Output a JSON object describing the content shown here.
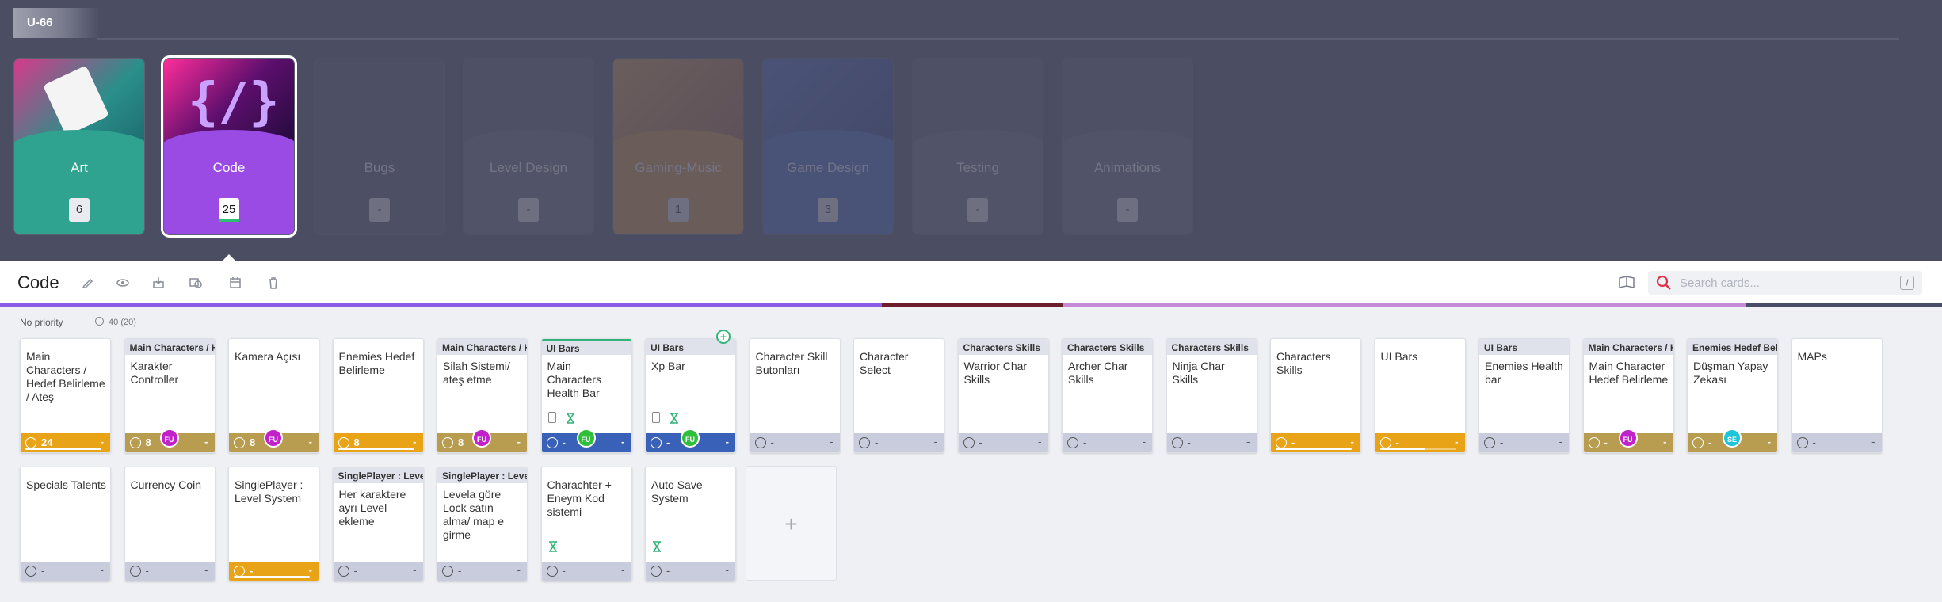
{
  "board": {
    "tab_label": "U-66"
  },
  "categories": [
    {
      "name": "Art",
      "count": "6"
    },
    {
      "name": "Code",
      "count": "25",
      "selected": true
    },
    {
      "name": "Bugs",
      "count": "-"
    },
    {
      "name": "Level Design",
      "count": "-"
    },
    {
      "name": "Gaming-Music",
      "count": "1"
    },
    {
      "name": "Game Design",
      "count": "3"
    },
    {
      "name": "Testing",
      "count": "-"
    },
    {
      "name": "Animations",
      "count": "-"
    }
  ],
  "header": {
    "title": "Code",
    "icons": [
      "edit-icon",
      "eye-icon",
      "archive-icon",
      "shapes-icon",
      "calendar-icon",
      "trash-icon"
    ],
    "search_placeholder": "Search cards...",
    "search_shortcut": "/"
  },
  "section": {
    "title": "No priority",
    "count": "40",
    "limit": "(20)"
  },
  "colors": {
    "accent": "#8a5ce6",
    "yellow": "#e8a317",
    "olive": "#b89c4f",
    "blue": "#3a61b8",
    "green": "#34b37a"
  },
  "cards_row1": [
    {
      "title": "Main Characters / Hedef Belirleme / Ateş",
      "foot": "yellow",
      "value": "24",
      "progress": 1.0
    },
    {
      "group": "Main Characters / Hedef",
      "title": "Karakter Controller",
      "foot": "olive",
      "value": "8",
      "avatar": "FU",
      "avatar_color": "#c021c9"
    },
    {
      "title": "Kamera Açısı",
      "foot": "olive",
      "value": "8",
      "avatar": "FU",
      "avatar_color": "#c021c9"
    },
    {
      "title": "Enemies Hedef Belirleme",
      "foot": "yellow",
      "value": "8",
      "progress": 1.0
    },
    {
      "group": "Main Characters / Hedef",
      "title": "Silah Sistemi/ ateş etme",
      "foot": "olive",
      "value": "8",
      "avatar": "FU",
      "avatar_color": "#c021c9"
    },
    {
      "group": "UI Bars",
      "title": "Main Characters Health Bar",
      "foot": "blue",
      "value": "-",
      "avatar": "FU",
      "avatar_color": "#2fbf3a",
      "green": true,
      "tasks": true
    },
    {
      "group": "UI Bars",
      "title": "Xp Bar",
      "foot": "blue",
      "value": "-",
      "avatar": "FU",
      "avatar_color": "#2fbf3a",
      "tasks": true
    },
    {
      "title": "Character Skill Butonları",
      "foot": "grey",
      "value": "-"
    },
    {
      "title": "Character Select",
      "foot": "grey",
      "value": "-"
    },
    {
      "group": "Characters Skills",
      "title": "Warrior Char Skills",
      "foot": "grey",
      "value": "-"
    },
    {
      "group": "Characters Skills",
      "title": "Archer Char Skills",
      "foot": "grey",
      "value": "-"
    },
    {
      "group": "Characters Skills",
      "title": "Ninja Char Skills",
      "foot": "grey",
      "value": "-"
    },
    {
      "title": "Characters Skills",
      "foot": "yellow",
      "value": "-",
      "progress": 1.0
    },
    {
      "title": "UI Bars",
      "foot": "yellow",
      "value": "-",
      "progress": 0.6
    },
    {
      "group": "UI Bars",
      "title": "Enemies Health bar",
      "foot": "grey",
      "value": "-"
    },
    {
      "group": "Main Characters / Hedef",
      "title": "Main Character Hedef Belirleme",
      "foot": "olive",
      "value": "-",
      "avatar": "FU",
      "avatar_color": "#c021c9"
    },
    {
      "group": "Enemies Hedef Belirleme",
      "title": "Düşman Yapay Zekası",
      "foot": "olive",
      "value": "-",
      "avatar": "SE",
      "avatar_color": "#1cc6d8"
    },
    {
      "title": "MAPs",
      "foot": "grey",
      "value": "-"
    }
  ],
  "cards_row2": [
    {
      "title": "Specials Talents",
      "foot": "grey",
      "value": "-"
    },
    {
      "title": "Currency Coin",
      "foot": "grey",
      "value": "-"
    },
    {
      "title": "SinglePlayer : Level System",
      "foot": "yellow",
      "value": "-",
      "progress": 1.0
    },
    {
      "group": "SinglePlayer : Level System",
      "title": "Her karaktere ayrı Level ekleme",
      "foot": "grey",
      "value": "-"
    },
    {
      "group": "SinglePlayer : Level System",
      "title": "Levela göre Lock satın alma/ map e girme",
      "foot": "grey",
      "value": "-"
    },
    {
      "title": "Charachter + Eneym Kod sistemi",
      "foot": "grey",
      "value": "-",
      "hourglass": true
    },
    {
      "title": "Auto Save System",
      "foot": "grey",
      "value": "-",
      "hourglass": true
    }
  ],
  "add_card_symbol": "+"
}
